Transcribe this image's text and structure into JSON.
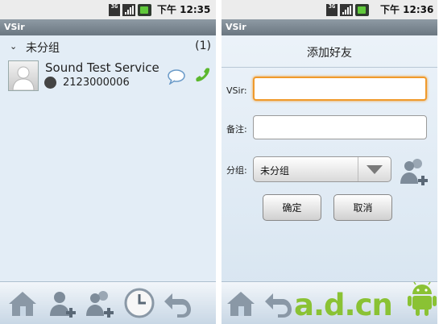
{
  "colors": {
    "accent_focus": "#f09a2c",
    "call_green": "#5cb82e",
    "watermark_green": "#8ac234"
  },
  "left": {
    "status": {
      "network_badge": "3G",
      "time": "下午 12:35"
    },
    "title": "VSir",
    "group": {
      "name": "未分组",
      "count": "(1)"
    },
    "contact": {
      "name": "Sound Test Service",
      "number": "2123000006",
      "status_icon": "offline-status-icon"
    },
    "toolbar": [
      "home-icon",
      "add-contact-icon",
      "add-group-icon",
      "clock-icon",
      "back-icon"
    ]
  },
  "right": {
    "status": {
      "network_badge": "3G",
      "time": "下午 12:36"
    },
    "title": "VSir",
    "dialog_title": "添加好友",
    "fields": {
      "vsir_label": "VSir:",
      "vsir_value": "",
      "note_label": "备注:",
      "note_value": "",
      "group_label": "分组:",
      "group_selected": "未分组"
    },
    "buttons": {
      "confirm": "确定",
      "cancel": "取消"
    },
    "toolbar": [
      "home-icon",
      "back-icon"
    ],
    "watermark": "a.d.cn"
  }
}
